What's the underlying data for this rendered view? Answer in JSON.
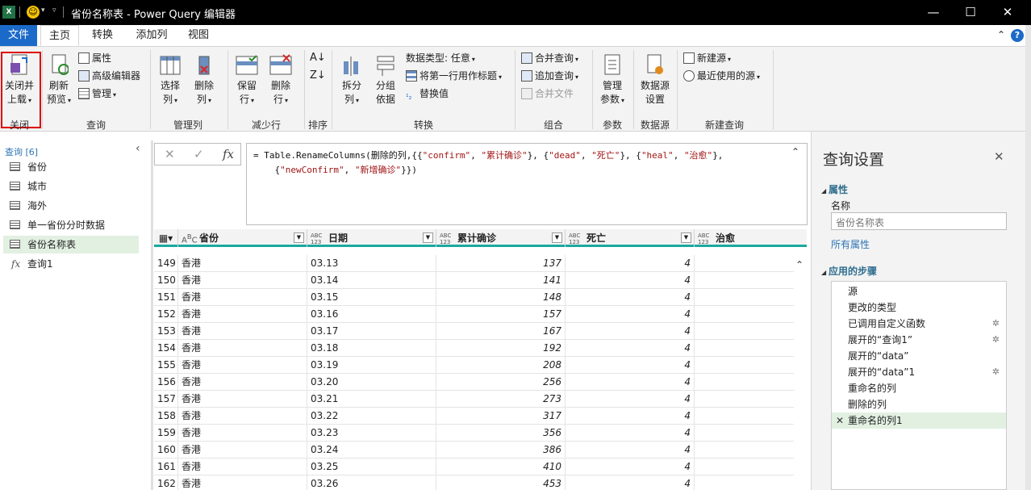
{
  "window": {
    "title": "省份名称表 - Power Query 编辑器",
    "app_icon": "X"
  },
  "tabs": [
    "文件",
    "主页",
    "转换",
    "添加列",
    "视图"
  ],
  "ribbon": {
    "close": {
      "button": "关闭并\n上载",
      "group": "关闭"
    },
    "query": {
      "refresh": "刷新\n预览",
      "properties": "属性",
      "advanced_editor": "高级编辑器",
      "manage": "管理",
      "group": "查询"
    },
    "manage_columns": {
      "choose": "选择\n列",
      "remove": "删除\n列",
      "group": "管理列"
    },
    "reduce_rows": {
      "keep": "保留\n行",
      "remove": "删除\n行",
      "group": "减少行"
    },
    "sort": {
      "group": "排序"
    },
    "transform": {
      "split": "拆分\n列",
      "group_by": "分组\n依据",
      "data_type": "数据类型: 任意",
      "first_row_header": "将第一行用作标题",
      "replace": "替换值",
      "group": "转换"
    },
    "combine": {
      "merge": "合并查询",
      "append": "追加查询",
      "combine_files": "合并文件",
      "group": "组合"
    },
    "params": {
      "manage": "管理\n参数",
      "group": "参数"
    },
    "datasource": {
      "settings": "数据源\n设置",
      "group": "数据源"
    },
    "new_query": {
      "new_source": "新建源",
      "recent": "最近使用的源",
      "group": "新建查询"
    }
  },
  "queries": {
    "header": "查询 [6]",
    "items": [
      {
        "label": "省份",
        "type": "table"
      },
      {
        "label": "城市",
        "type": "table"
      },
      {
        "label": "海外",
        "type": "table"
      },
      {
        "label": "单一省份分时数据",
        "type": "table"
      },
      {
        "label": "省份名称表",
        "type": "table",
        "selected": true
      },
      {
        "label": "查询1",
        "type": "function"
      }
    ]
  },
  "formula": {
    "line1_a": "= Table.RenameColumns(删除的列,{{",
    "s_confirm": "\"confirm\"",
    "s_leiji": "\"累计确诊\"",
    "s_dead": "\"dead\"",
    "s_siwang": "\"死亡\"",
    "s_heal": "\"heal\"",
    "s_zhiyu": "\"治愈\"",
    "line2_a": "    {",
    "s_new": "\"newConfirm\"",
    "s_xinzeng": "\"新增确诊\"",
    "line2_end": "}})",
    "sep1": ", ",
    "sep2": "}, {",
    "sep3": "},"
  },
  "grid": {
    "columns": [
      {
        "name": "省份",
        "type": "ABC"
      },
      {
        "name": "日期",
        "type": "ABC\n123"
      },
      {
        "name": "累计确诊",
        "type": "ABC\n123"
      },
      {
        "name": "死亡",
        "type": "ABC\n123"
      },
      {
        "name": "治愈",
        "type": "ABC\n123"
      }
    ],
    "rows": [
      {
        "idx": "149",
        "prov": "香港",
        "date": "03.13",
        "total": "137",
        "dead": "4"
      },
      {
        "idx": "150",
        "prov": "香港",
        "date": "03.14",
        "total": "141",
        "dead": "4"
      },
      {
        "idx": "151",
        "prov": "香港",
        "date": "03.15",
        "total": "148",
        "dead": "4"
      },
      {
        "idx": "152",
        "prov": "香港",
        "date": "03.16",
        "total": "157",
        "dead": "4"
      },
      {
        "idx": "153",
        "prov": "香港",
        "date": "03.17",
        "total": "167",
        "dead": "4"
      },
      {
        "idx": "154",
        "prov": "香港",
        "date": "03.18",
        "total": "192",
        "dead": "4"
      },
      {
        "idx": "155",
        "prov": "香港",
        "date": "03.19",
        "total": "208",
        "dead": "4"
      },
      {
        "idx": "156",
        "prov": "香港",
        "date": "03.20",
        "total": "256",
        "dead": "4"
      },
      {
        "idx": "157",
        "prov": "香港",
        "date": "03.21",
        "total": "273",
        "dead": "4"
      },
      {
        "idx": "158",
        "prov": "香港",
        "date": "03.22",
        "total": "317",
        "dead": "4"
      },
      {
        "idx": "159",
        "prov": "香港",
        "date": "03.23",
        "total": "356",
        "dead": "4"
      },
      {
        "idx": "160",
        "prov": "香港",
        "date": "03.24",
        "total": "386",
        "dead": "4"
      },
      {
        "idx": "161",
        "prov": "香港",
        "date": "03.25",
        "total": "410",
        "dead": "4"
      },
      {
        "idx": "162",
        "prov": "香港",
        "date": "03.26",
        "total": "453",
        "dead": "4"
      }
    ]
  },
  "settings": {
    "title": "查询设置",
    "properties_header": "属性",
    "name_label": "名称",
    "name_value": "省份名称表",
    "all_properties": "所有属性",
    "steps_header": "应用的步骤",
    "steps": [
      {
        "label": "源",
        "gear": false
      },
      {
        "label": "更改的类型",
        "gear": false
      },
      {
        "label": "已调用自定义函数",
        "gear": true
      },
      {
        "label": "展开的“查询1”",
        "gear": true
      },
      {
        "label": "展开的“data”",
        "gear": false
      },
      {
        "label": "展开的“data”1",
        "gear": true
      },
      {
        "label": "重命名的列",
        "gear": false
      },
      {
        "label": "删除的列",
        "gear": false
      },
      {
        "label": "重命名的列1",
        "gear": false,
        "selected": true
      }
    ]
  }
}
